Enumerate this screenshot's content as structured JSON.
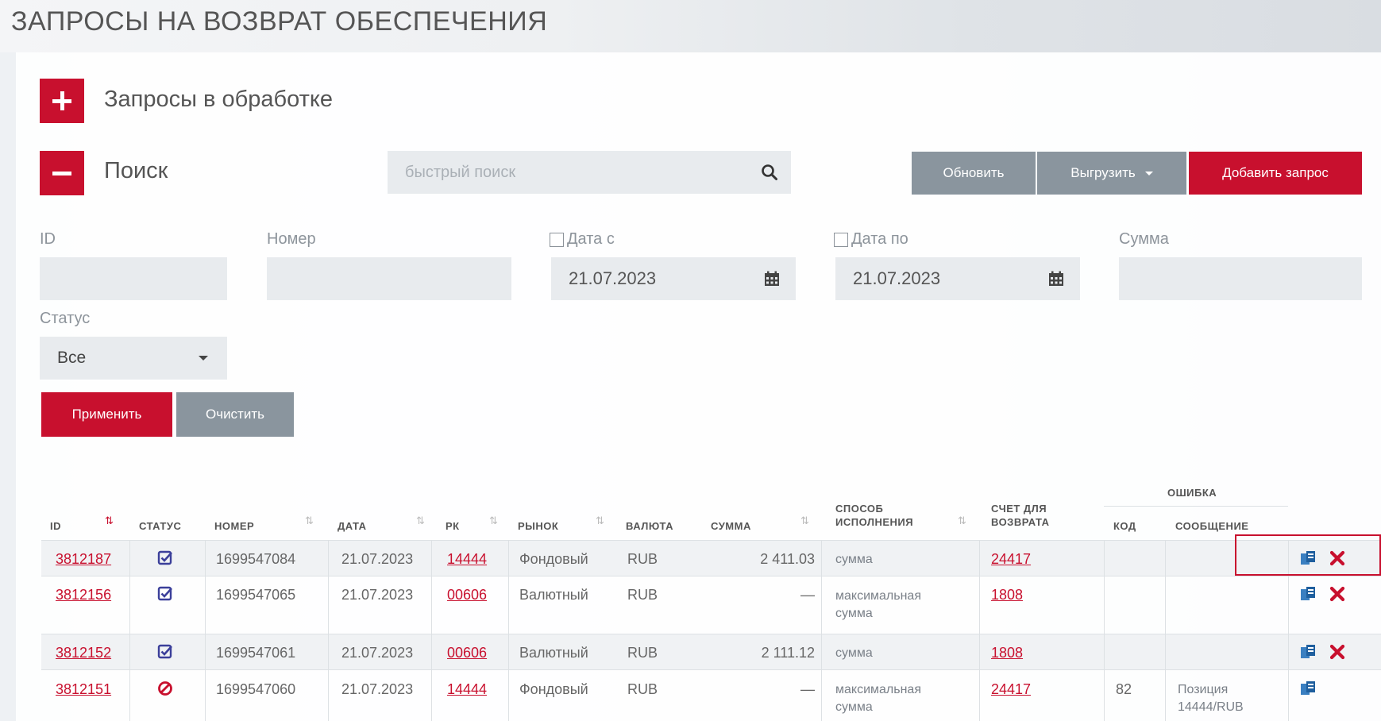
{
  "page": {
    "title": "ЗАПРОСЫ НА ВОЗВРАТ ОБЕСПЕЧЕНИЯ"
  },
  "sections": {
    "in_progress": "Запросы в обработке",
    "search": "Поиск"
  },
  "quick_search": {
    "placeholder": "быстрый поиск"
  },
  "toolbar": {
    "refresh": "Обновить",
    "export": "Выгрузить",
    "add": "Добавить запрос"
  },
  "filters": {
    "id_label": "ID",
    "number_label": "Номер",
    "date_from_label": "Дата с",
    "date_from_value": "21.07.2023",
    "date_to_label": "Дата по",
    "date_to_value": "21.07.2023",
    "sum_label": "Сумма",
    "status_label": "Статус",
    "status_value": "Все",
    "apply": "Применить",
    "clear": "Очистить"
  },
  "table": {
    "headers": {
      "id": "ID",
      "status": "СТАТУС",
      "number": "НОМЕР",
      "date": "ДАТА",
      "rk": "РК",
      "market": "РЫНОК",
      "currency": "ВАЛЮТА",
      "sum": "СУММА",
      "method_1": "СПОСОБ",
      "method_2": "ИСПОЛНЕНИЯ",
      "account_1": "СЧЕТ ДЛЯ",
      "account_2": "ВОЗВРАТА",
      "error": "ОШИБКА",
      "code": "КОД",
      "message": "СООБЩЕНИЕ"
    },
    "rows": [
      {
        "id": "3812187",
        "number": "1699547084",
        "date": "21.07.2023",
        "rk": "14444",
        "market": "Фондовый",
        "currency": "RUB",
        "sum": "2 411.03",
        "method_1": "сумма",
        "method_2": "",
        "account": "24417",
        "code": "",
        "message_1": "",
        "message_2": ""
      },
      {
        "id": "3812156",
        "number": "1699547065",
        "date": "21.07.2023",
        "rk": "00606",
        "market": "Валютный",
        "currency": "RUB",
        "sum": "—",
        "method_1": "максимальная",
        "method_2": "сумма",
        "account": "1808",
        "code": "",
        "message_1": "",
        "message_2": ""
      },
      {
        "id": "3812152",
        "number": "1699547061",
        "date": "21.07.2023",
        "rk": "00606",
        "market": "Валютный",
        "currency": "RUB",
        "sum": "2 111.12",
        "method_1": "сумма",
        "method_2": "",
        "account": "1808",
        "code": "",
        "message_1": "",
        "message_2": ""
      },
      {
        "id": "3812151",
        "number": "1699547060",
        "date": "21.07.2023",
        "rk": "14444",
        "market": "Фондовый",
        "currency": "RUB",
        "sum": "—",
        "method_1": "максимальная",
        "method_2": "сумма",
        "account": "24417",
        "code": "82",
        "message_1": "Позиция",
        "message_2": "14444/RUB"
      }
    ]
  },
  "colors": {
    "accent": "#c8102e",
    "gray_button": "#8a959e",
    "input_bg": "#e8ebee",
    "status_icon": "#3b3f9a"
  }
}
